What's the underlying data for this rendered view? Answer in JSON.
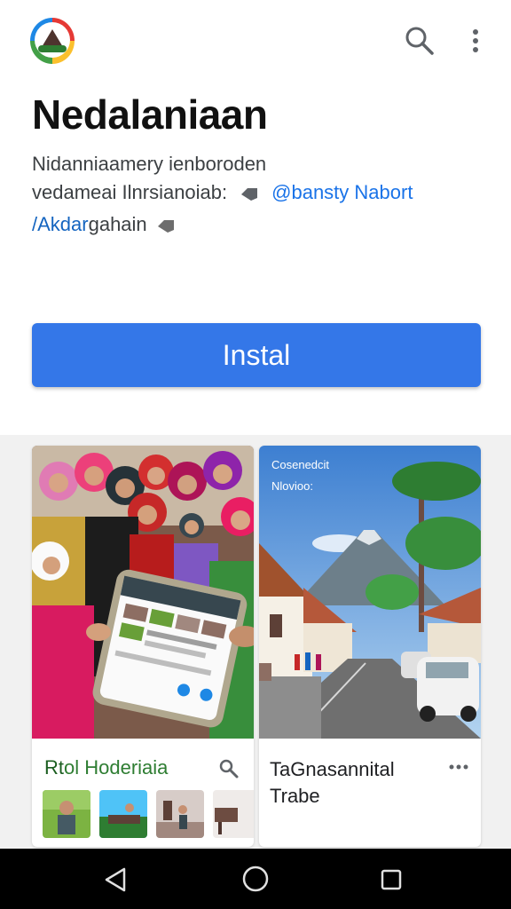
{
  "app": {
    "title": "Nedalaniaan",
    "description_line1": "Nidanniaamery ienboroden",
    "description_line2_text": "vedameai Ilnrsianoiab:",
    "description_line2_link": "@bansty Nabort",
    "description_line3_link": "/Akdar",
    "description_line3_text": "gahain",
    "install_label": "Instal"
  },
  "colors": {
    "accent": "#3477e8",
    "link": "#1a73e8",
    "card1_title": "#1b5e20"
  },
  "icons": {
    "logo": "app-logo-icon",
    "search": "search-icon",
    "more": "more-vert-icon",
    "tag": "tag-icon",
    "back": "nav-back-icon",
    "home": "nav-home-icon",
    "recents": "nav-recents-icon"
  },
  "cards": [
    {
      "title_prefix": "Rt",
      "title_rest": "ol Hoderiaia",
      "thumbnails": [
        "thumb-person",
        "thumb-boat",
        "thumb-room",
        "thumb-interior"
      ]
    },
    {
      "overlay_line1": "Cosenedcit",
      "overlay_line2": "Nlovioo:",
      "title": "TaGnasannital Trabe"
    }
  ]
}
